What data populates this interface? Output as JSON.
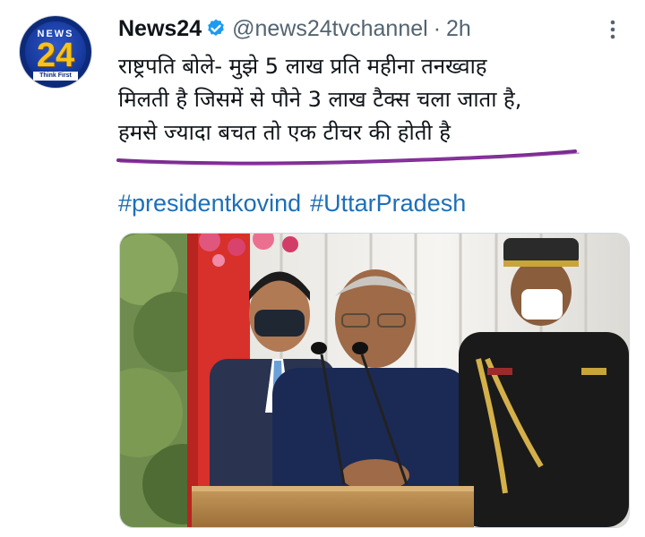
{
  "account": {
    "avatar_top_text": "NEWS",
    "avatar_number": "24",
    "avatar_tagline": "Think First",
    "name": "News24",
    "handle": "@news24tvchannel",
    "separator": "·",
    "time": "2h"
  },
  "tweet": {
    "lines": [
      "राष्ट्रपति बोले- मुझे 5 लाख प्रति महीना तनख्वाह",
      "मिलती है जिसमें से पौने 3 लाख टैक्स चला जाता है,",
      "हमसे ज्यादा बचत तो एक टीचर की होती है"
    ],
    "hashtags": [
      "#presidentkovind",
      "#UttarPradesh"
    ]
  },
  "colors": {
    "handle": "#536471",
    "hashtag": "#1d6fb8",
    "verified": "#1d9bf0",
    "underline": "#7a2a8f"
  },
  "icons": [
    "verified-badge-icon",
    "more-options-icon"
  ]
}
